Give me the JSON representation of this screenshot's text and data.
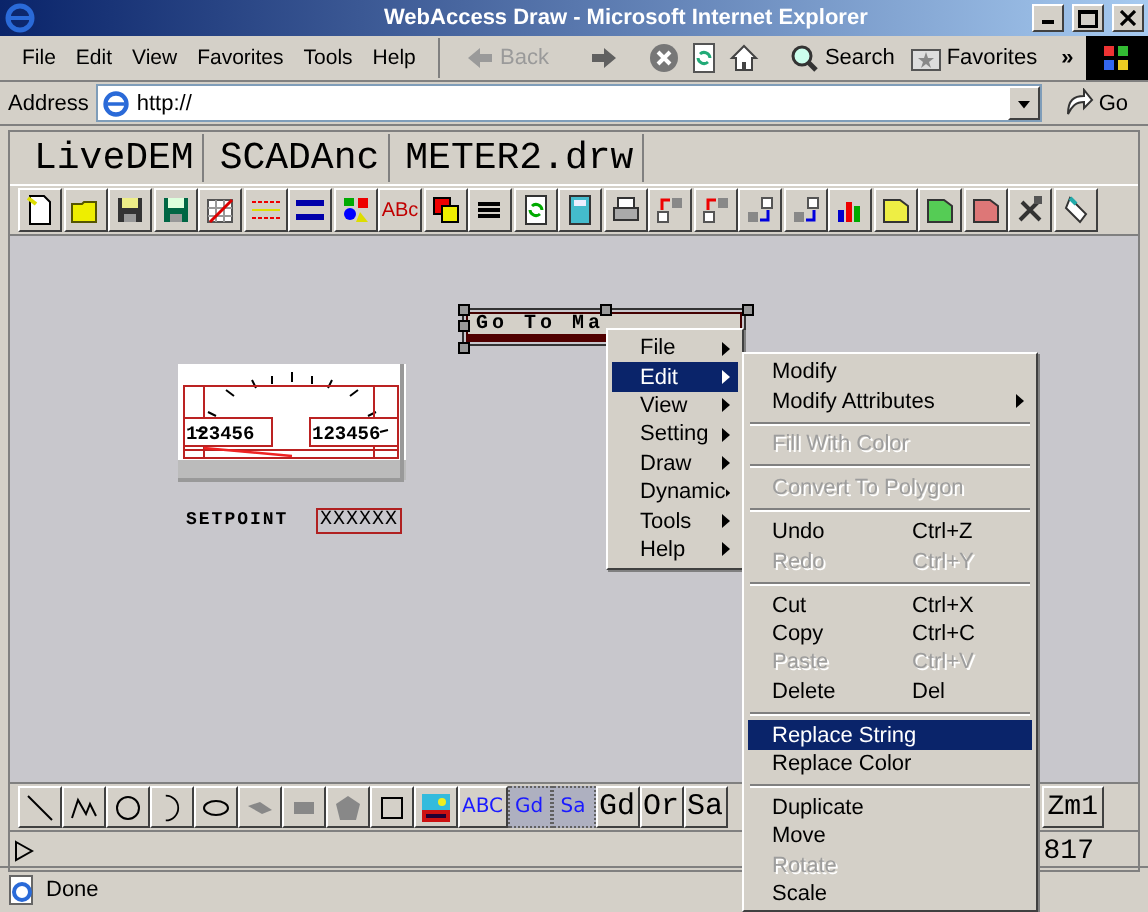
{
  "window": {
    "title": "WebAccess Draw - Microsoft Internet Explorer"
  },
  "menu_bar": [
    "File",
    "Edit",
    "View",
    "Favorites",
    "Tools",
    "Help"
  ],
  "browser_toolbar": {
    "back": "Back",
    "search": "Search",
    "favorites": "Favorites",
    "more": "»"
  },
  "address_bar": {
    "label": "Address",
    "value": "http://",
    "go": "Go"
  },
  "file_fields": [
    "LiveDEM",
    "SCADAnc",
    "METER2.drw"
  ],
  "tool_label": "ABc",
  "canvas": {
    "meter": {
      "left_readout": "123456",
      "right_readout": "123456"
    },
    "setpoint": {
      "label": "SETPOINT",
      "value": "XXXXXX"
    },
    "button": {
      "label": "Go To Ma",
      "selected": true
    }
  },
  "context_menu": {
    "items": [
      {
        "label": "File",
        "selected": false
      },
      {
        "label": "Edit",
        "selected": true
      },
      {
        "label": "View",
        "selected": false
      },
      {
        "label": "Setting",
        "selected": false
      },
      {
        "label": "Draw",
        "selected": false
      },
      {
        "label": "Dynamic",
        "selected": false
      },
      {
        "label": "Tools",
        "selected": false
      },
      {
        "label": "Help",
        "selected": false
      }
    ]
  },
  "submenu": {
    "items": [
      {
        "kind": "item",
        "label": "Modify",
        "disabled": false,
        "selected": false,
        "has_submenu": false
      },
      {
        "kind": "item",
        "label": "Modify Attributes",
        "disabled": false,
        "selected": false,
        "has_submenu": true
      },
      {
        "kind": "separator"
      },
      {
        "kind": "item",
        "label": "Fill With Color",
        "disabled": true,
        "selected": false,
        "has_submenu": false
      },
      {
        "kind": "separator"
      },
      {
        "kind": "item",
        "label": "Convert To Polygon",
        "disabled": true,
        "selected": false,
        "has_submenu": false
      },
      {
        "kind": "separator"
      },
      {
        "kind": "item",
        "label": "Undo",
        "shortcut": "Ctrl+Z",
        "disabled": false,
        "selected": false,
        "has_submenu": false
      },
      {
        "kind": "item",
        "label": "Redo",
        "shortcut": "Ctrl+Y",
        "disabled": true,
        "selected": false,
        "has_submenu": false
      },
      {
        "kind": "separator"
      },
      {
        "kind": "item",
        "label": "Cut",
        "shortcut": "Ctrl+X",
        "disabled": false,
        "selected": false,
        "has_submenu": false
      },
      {
        "kind": "item",
        "label": "Copy",
        "shortcut": "Ctrl+C",
        "disabled": false,
        "selected": false,
        "has_submenu": false
      },
      {
        "kind": "item",
        "label": "Paste",
        "shortcut": "Ctrl+V",
        "disabled": true,
        "selected": false,
        "has_submenu": false
      },
      {
        "kind": "item",
        "label": "Delete",
        "shortcut": "Del",
        "disabled": false,
        "selected": false,
        "has_submenu": false
      },
      {
        "kind": "separator"
      },
      {
        "kind": "item",
        "label": "Replace String",
        "disabled": false,
        "selected": true,
        "has_submenu": false
      },
      {
        "kind": "item",
        "label": "Replace Color",
        "disabled": false,
        "selected": false,
        "has_submenu": false
      },
      {
        "kind": "separator"
      },
      {
        "kind": "item",
        "label": "Duplicate",
        "disabled": false,
        "selected": false,
        "has_submenu": false
      },
      {
        "kind": "item",
        "label": "Move",
        "disabled": false,
        "selected": false,
        "has_submenu": false
      },
      {
        "kind": "item",
        "label": "Rotate",
        "disabled": true,
        "selected": false,
        "has_submenu": false
      },
      {
        "kind": "item",
        "label": "Scale",
        "disabled": false,
        "selected": false,
        "has_submenu": false
      }
    ]
  },
  "drawing_toolbar": {
    "text_tools": [
      {
        "label": "ABC",
        "kind": "blue",
        "selected": false
      },
      {
        "label": "Gd",
        "kind": "blue",
        "selected": true
      },
      {
        "label": "Sa",
        "kind": "blue",
        "selected": true
      },
      {
        "label": "Gd",
        "kind": "plain",
        "selected": false
      },
      {
        "label": "Or",
        "kind": "plain",
        "selected": false
      },
      {
        "label": "Sa",
        "kind": "plain",
        "selected": false
      }
    ],
    "zoom": "Zm1"
  },
  "command_line": {
    "value": "817"
  },
  "status_bar": {
    "text": "Done"
  }
}
